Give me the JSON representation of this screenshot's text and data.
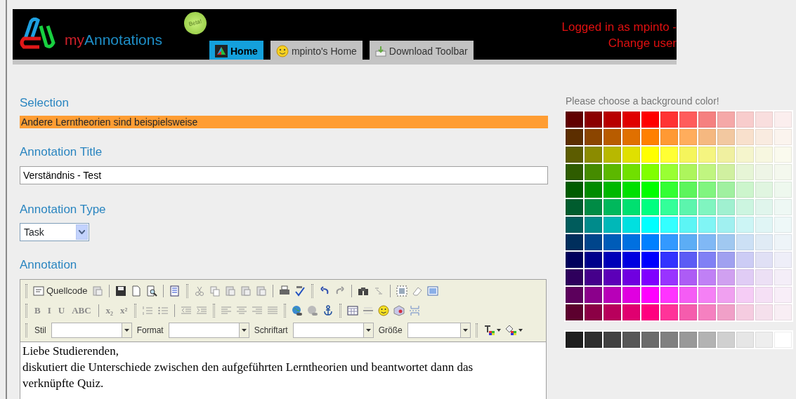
{
  "header": {
    "logo": {
      "prefix": "my",
      "name": "Annotations"
    },
    "badge": "Beta!",
    "tabs": [
      {
        "label": "Home",
        "selected": true
      },
      {
        "label": "mpinto's Home",
        "selected": false
      },
      {
        "label": "Download Toolbar",
        "selected": false
      }
    ],
    "user": {
      "line": "Logged in as mpinto -",
      "link": "Change user"
    }
  },
  "form": {
    "selection": {
      "label": "Selection",
      "text": "Andere Lerntheorien sind beispielsweise"
    },
    "title": {
      "label": "Annotation Title",
      "value": "Verständnis - Test"
    },
    "type": {
      "label": "Annotation Type",
      "value": "Task"
    },
    "annotation": {
      "label": "Annotation",
      "source_button": "Quellcode",
      "format_buttons": [
        "B",
        "I",
        "U",
        "ABC",
        "x₂",
        "x²"
      ],
      "combos": [
        "Stil",
        "Format",
        "Schriftart",
        "Größe"
      ],
      "paragraphs": [
        "Liebe Studierenden,",
        "diskutiert die Unterschiede zwischen den aufgeführten Lerntheorien und beantwortet dann das verknüpfte Quiz."
      ]
    }
  },
  "palette": {
    "label": "Please choose a background color!",
    "rows": [
      [
        {
          "color": "#600000"
        },
        {
          "color": "#8b0000"
        },
        {
          "color": "#b80000"
        },
        {
          "color": "#e00000"
        },
        {
          "color": "#ff0000"
        },
        {
          "color": "#ff3333"
        },
        {
          "color": "#ff5c5c"
        },
        {
          "color": "#f58080"
        },
        {
          "color": "#f5a8a8"
        },
        {
          "color": "#f8cccc"
        },
        {
          "color": "#f9dede"
        },
        {
          "color": "#fbeeee"
        }
      ],
      [
        {
          "color": "#5c2e00"
        },
        {
          "color": "#8b4500"
        },
        {
          "color": "#b85c00"
        },
        {
          "color": "#e07000"
        },
        {
          "color": "#ff8000"
        },
        {
          "color": "#ff9933"
        },
        {
          "color": "#ffad5c"
        },
        {
          "color": "#f5b880"
        },
        {
          "color": "#f2c8a0"
        },
        {
          "color": "#f8e0cc"
        },
        {
          "color": "#f9ebe0"
        },
        {
          "color": "#fbf4ee"
        }
      ],
      [
        {
          "color": "#5c5c00"
        },
        {
          "color": "#8b8b00"
        },
        {
          "color": "#b8b800"
        },
        {
          "color": "#e0e000"
        },
        {
          "color": "#ffff00"
        },
        {
          "color": "#ffff33"
        },
        {
          "color": "#f5f55c"
        },
        {
          "color": "#f5f580"
        },
        {
          "color": "#f0f0a0"
        },
        {
          "color": "#f5f5cc"
        },
        {
          "color": "#f7f7e0"
        },
        {
          "color": "#fafaee"
        }
      ],
      [
        {
          "color": "#2e5c00"
        },
        {
          "color": "#458b00"
        },
        {
          "color": "#5cb800"
        },
        {
          "color": "#70e000"
        },
        {
          "color": "#80ff00"
        },
        {
          "color": "#99ff33"
        },
        {
          "color": "#adf55c"
        },
        {
          "color": "#c0f580"
        },
        {
          "color": "#d0f0a0"
        },
        {
          "color": "#e6f5d6"
        },
        {
          "color": "#eef5e6"
        },
        {
          "color": "#f4f8ee"
        }
      ],
      [
        {
          "color": "#005c00"
        },
        {
          "color": "#008b00"
        },
        {
          "color": "#00b800"
        },
        {
          "color": "#00e000"
        },
        {
          "color": "#00ff00"
        },
        {
          "color": "#33ff33"
        },
        {
          "color": "#5cf55c"
        },
        {
          "color": "#80f580"
        },
        {
          "color": "#a0f0a0"
        },
        {
          "color": "#ccf5cc"
        },
        {
          "color": "#e0f5e0"
        },
        {
          "color": "#eef8ee"
        }
      ],
      [
        {
          "color": "#005c2e"
        },
        {
          "color": "#008b45"
        },
        {
          "color": "#00b85c"
        },
        {
          "color": "#00e070"
        },
        {
          "color": "#00ff80"
        },
        {
          "color": "#33ff99"
        },
        {
          "color": "#5cf5ad"
        },
        {
          "color": "#80f5c0"
        },
        {
          "color": "#a0f0d0"
        },
        {
          "color": "#ccf5e0"
        },
        {
          "color": "#e0f5ec"
        },
        {
          "color": "#eef8f4"
        }
      ],
      [
        {
          "color": "#005c5c"
        },
        {
          "color": "#008b8b"
        },
        {
          "color": "#00b8b8"
        },
        {
          "color": "#00e0e0"
        },
        {
          "color": "#00ffff"
        },
        {
          "color": "#33ffff"
        },
        {
          "color": "#5cf5f5"
        },
        {
          "color": "#80f5f5"
        },
        {
          "color": "#a0f0f0"
        },
        {
          "color": "#ccf5f5"
        },
        {
          "color": "#e0f5f5"
        },
        {
          "color": "#eef8f8"
        }
      ],
      [
        {
          "color": "#002e5c"
        },
        {
          "color": "#00458b"
        },
        {
          "color": "#005cb8"
        },
        {
          "color": "#0070e0"
        },
        {
          "color": "#0080ff"
        },
        {
          "color": "#3399ff"
        },
        {
          "color": "#5cadf5"
        },
        {
          "color": "#80b8f5"
        },
        {
          "color": "#a0c8f0"
        },
        {
          "color": "#cce0f5"
        },
        {
          "color": "#e0ebf5"
        },
        {
          "color": "#eef4f8"
        }
      ],
      [
        {
          "color": "#00005c"
        },
        {
          "color": "#00008b"
        },
        {
          "color": "#0000b8"
        },
        {
          "color": "#0000e0"
        },
        {
          "color": "#0000ff"
        },
        {
          "color": "#3333ff"
        },
        {
          "color": "#5c5cf5"
        },
        {
          "color": "#8080f5"
        },
        {
          "color": "#a0a0f0"
        },
        {
          "color": "#ccccf5"
        },
        {
          "color": "#e0e0f5"
        },
        {
          "color": "#eeeef8"
        }
      ],
      [
        {
          "color": "#2e005c"
        },
        {
          "color": "#45008b"
        },
        {
          "color": "#5c00b8"
        },
        {
          "color": "#7000e0"
        },
        {
          "color": "#8000ff"
        },
        {
          "color": "#9933ff"
        },
        {
          "color": "#ad5cf5"
        },
        {
          "color": "#c080f5"
        },
        {
          "color": "#d0a0f0"
        },
        {
          "color": "#e0ccf5"
        },
        {
          "color": "#ece0f5"
        },
        {
          "color": "#f4eef8"
        }
      ],
      [
        {
          "color": "#5c005c"
        },
        {
          "color": "#8b008b"
        },
        {
          "color": "#b800b8"
        },
        {
          "color": "#e000e0"
        },
        {
          "color": "#ff00ff"
        },
        {
          "color": "#ff33ff"
        },
        {
          "color": "#f55cf5"
        },
        {
          "color": "#f580f5"
        },
        {
          "color": "#f0a0f0"
        },
        {
          "color": "#f5ccf5"
        },
        {
          "color": "#f5e0f5"
        },
        {
          "color": "#f8eef8"
        }
      ],
      [
        {
          "color": "#5c002e"
        },
        {
          "color": "#8b0045"
        },
        {
          "color": "#b8005c"
        },
        {
          "color": "#e00070"
        },
        {
          "color": "#ff0080"
        },
        {
          "color": "#ff3399"
        },
        {
          "color": "#f55cad"
        },
        {
          "color": "#f580c0"
        },
        {
          "color": "#f0a0c8"
        },
        {
          "color": "#f5cce0"
        },
        {
          "color": "#f5e0ec"
        },
        {
          "color": "#f8eef4"
        }
      ]
    ],
    "grays": [
      {
        "color": "#1e1e1e"
      },
      {
        "color": "#2e2e2e"
      },
      {
        "color": "#424242"
      },
      {
        "color": "#575757"
      },
      {
        "color": "#6b6b6b"
      },
      {
        "color": "#808080"
      },
      {
        "color": "#999999"
      },
      {
        "color": "#b3b3b3"
      },
      {
        "color": "#d0d0d0"
      },
      {
        "color": "#e6e6e6"
      },
      {
        "color": "#eeeeee"
      },
      {
        "color": "#ffffff"
      }
    ]
  }
}
